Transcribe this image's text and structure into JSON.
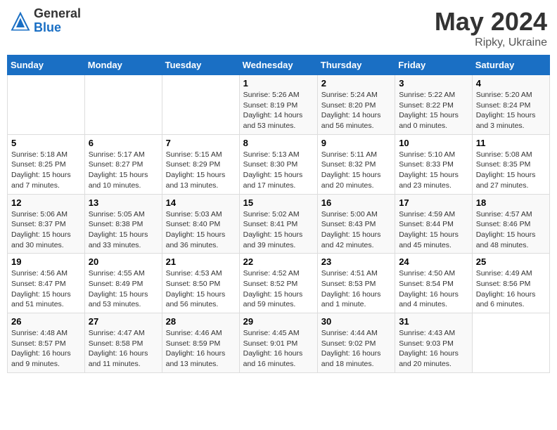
{
  "header": {
    "logo_general": "General",
    "logo_blue": "Blue",
    "title": "May 2024",
    "location": "Ripky, Ukraine"
  },
  "days_of_week": [
    "Sunday",
    "Monday",
    "Tuesday",
    "Wednesday",
    "Thursday",
    "Friday",
    "Saturday"
  ],
  "weeks": [
    {
      "days": [
        {
          "num": "",
          "info": ""
        },
        {
          "num": "",
          "info": ""
        },
        {
          "num": "",
          "info": ""
        },
        {
          "num": "1",
          "info": "Sunrise: 5:26 AM\nSunset: 8:19 PM\nDaylight: 14 hours and 53 minutes."
        },
        {
          "num": "2",
          "info": "Sunrise: 5:24 AM\nSunset: 8:20 PM\nDaylight: 14 hours and 56 minutes."
        },
        {
          "num": "3",
          "info": "Sunrise: 5:22 AM\nSunset: 8:22 PM\nDaylight: 15 hours and 0 minutes."
        },
        {
          "num": "4",
          "info": "Sunrise: 5:20 AM\nSunset: 8:24 PM\nDaylight: 15 hours and 3 minutes."
        }
      ]
    },
    {
      "days": [
        {
          "num": "5",
          "info": "Sunrise: 5:18 AM\nSunset: 8:25 PM\nDaylight: 15 hours and 7 minutes."
        },
        {
          "num": "6",
          "info": "Sunrise: 5:17 AM\nSunset: 8:27 PM\nDaylight: 15 hours and 10 minutes."
        },
        {
          "num": "7",
          "info": "Sunrise: 5:15 AM\nSunset: 8:29 PM\nDaylight: 15 hours and 13 minutes."
        },
        {
          "num": "8",
          "info": "Sunrise: 5:13 AM\nSunset: 8:30 PM\nDaylight: 15 hours and 17 minutes."
        },
        {
          "num": "9",
          "info": "Sunrise: 5:11 AM\nSunset: 8:32 PM\nDaylight: 15 hours and 20 minutes."
        },
        {
          "num": "10",
          "info": "Sunrise: 5:10 AM\nSunset: 8:33 PM\nDaylight: 15 hours and 23 minutes."
        },
        {
          "num": "11",
          "info": "Sunrise: 5:08 AM\nSunset: 8:35 PM\nDaylight: 15 hours and 27 minutes."
        }
      ]
    },
    {
      "days": [
        {
          "num": "12",
          "info": "Sunrise: 5:06 AM\nSunset: 8:37 PM\nDaylight: 15 hours and 30 minutes."
        },
        {
          "num": "13",
          "info": "Sunrise: 5:05 AM\nSunset: 8:38 PM\nDaylight: 15 hours and 33 minutes."
        },
        {
          "num": "14",
          "info": "Sunrise: 5:03 AM\nSunset: 8:40 PM\nDaylight: 15 hours and 36 minutes."
        },
        {
          "num": "15",
          "info": "Sunrise: 5:02 AM\nSunset: 8:41 PM\nDaylight: 15 hours and 39 minutes."
        },
        {
          "num": "16",
          "info": "Sunrise: 5:00 AM\nSunset: 8:43 PM\nDaylight: 15 hours and 42 minutes."
        },
        {
          "num": "17",
          "info": "Sunrise: 4:59 AM\nSunset: 8:44 PM\nDaylight: 15 hours and 45 minutes."
        },
        {
          "num": "18",
          "info": "Sunrise: 4:57 AM\nSunset: 8:46 PM\nDaylight: 15 hours and 48 minutes."
        }
      ]
    },
    {
      "days": [
        {
          "num": "19",
          "info": "Sunrise: 4:56 AM\nSunset: 8:47 PM\nDaylight: 15 hours and 51 minutes."
        },
        {
          "num": "20",
          "info": "Sunrise: 4:55 AM\nSunset: 8:49 PM\nDaylight: 15 hours and 53 minutes."
        },
        {
          "num": "21",
          "info": "Sunrise: 4:53 AM\nSunset: 8:50 PM\nDaylight: 15 hours and 56 minutes."
        },
        {
          "num": "22",
          "info": "Sunrise: 4:52 AM\nSunset: 8:52 PM\nDaylight: 15 hours and 59 minutes."
        },
        {
          "num": "23",
          "info": "Sunrise: 4:51 AM\nSunset: 8:53 PM\nDaylight: 16 hours and 1 minute."
        },
        {
          "num": "24",
          "info": "Sunrise: 4:50 AM\nSunset: 8:54 PM\nDaylight: 16 hours and 4 minutes."
        },
        {
          "num": "25",
          "info": "Sunrise: 4:49 AM\nSunset: 8:56 PM\nDaylight: 16 hours and 6 minutes."
        }
      ]
    },
    {
      "days": [
        {
          "num": "26",
          "info": "Sunrise: 4:48 AM\nSunset: 8:57 PM\nDaylight: 16 hours and 9 minutes."
        },
        {
          "num": "27",
          "info": "Sunrise: 4:47 AM\nSunset: 8:58 PM\nDaylight: 16 hours and 11 minutes."
        },
        {
          "num": "28",
          "info": "Sunrise: 4:46 AM\nSunset: 8:59 PM\nDaylight: 16 hours and 13 minutes."
        },
        {
          "num": "29",
          "info": "Sunrise: 4:45 AM\nSunset: 9:01 PM\nDaylight: 16 hours and 16 minutes."
        },
        {
          "num": "30",
          "info": "Sunrise: 4:44 AM\nSunset: 9:02 PM\nDaylight: 16 hours and 18 minutes."
        },
        {
          "num": "31",
          "info": "Sunrise: 4:43 AM\nSunset: 9:03 PM\nDaylight: 16 hours and 20 minutes."
        },
        {
          "num": "",
          "info": ""
        }
      ]
    }
  ]
}
